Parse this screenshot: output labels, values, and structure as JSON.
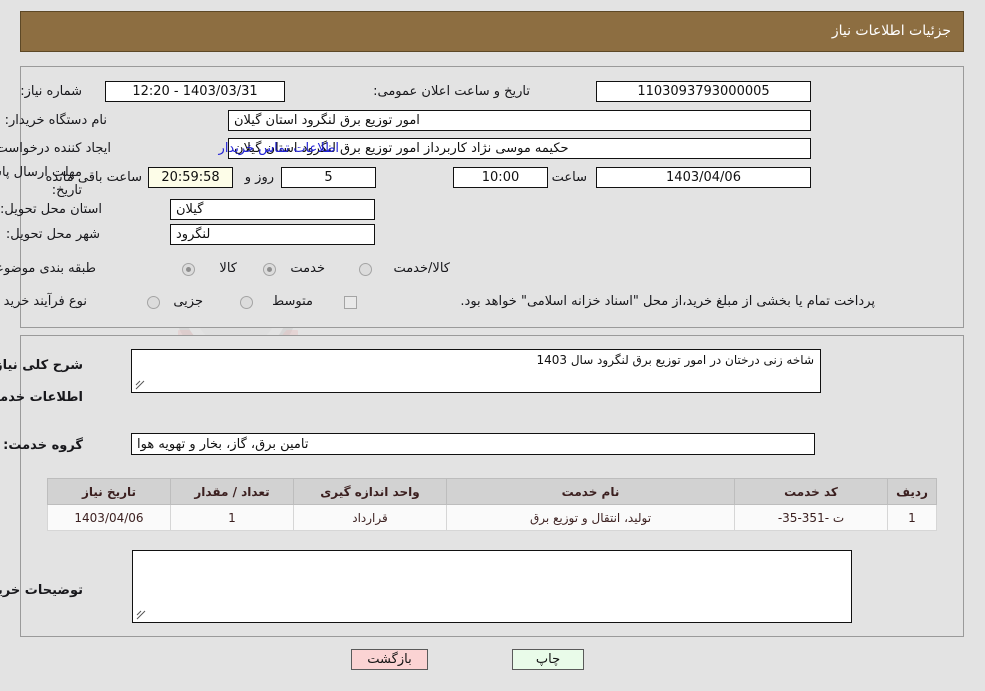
{
  "header": {
    "title": "جزئیات اطلاعات نیاز"
  },
  "form": {
    "need_number_label": "شماره نیاز:",
    "need_number_value": "1103093793000005",
    "announce_datetime_label": "تاریخ و ساعت اعلان عمومی:",
    "announce_datetime_value": "1403/03/31 - 12:20",
    "buyer_org_label": "نام دستگاه خریدار:",
    "buyer_org_value": "امور توزیع برق لنگرود استان گیلان",
    "creator_label": "ایجاد کننده درخواست:",
    "creator_value": "حکیمه موسی نژاد کاربرداز امور توزیع برق لنگرود استان گیلان",
    "buyer_contact_link": "اطلاعات تماس خریدار",
    "deadline_label_line1": "مهلت ارسال پاسخ: تا",
    "deadline_label_line2": "تاریخ:",
    "deadline_date_value": "1403/04/06",
    "hour_label": "ساعت",
    "hour_value": "10:00",
    "days_value": "5",
    "days_label": "روز و",
    "countdown_value": "20:59:58",
    "remaining_label": "ساعت باقی مانده",
    "province_label": "استان محل تحویل:",
    "province_value": "گیلان",
    "city_label": "شهر محل تحویل:",
    "city_value": "لنگرود",
    "category_label": "طبقه بندی موضوعی:",
    "category_options": [
      {
        "label": "کالا",
        "selected": false
      },
      {
        "label": "خدمت",
        "selected": true
      },
      {
        "label": "کالا/خدمت",
        "selected": false
      }
    ],
    "purchase_type_label": "نوع فرآیند خرید :",
    "purchase_type_options": [
      {
        "label": "جزیی",
        "selected": false
      },
      {
        "label": "متوسط",
        "selected": false
      }
    ],
    "treasury_checkbox_label": "پرداخت تمام یا بخشی از مبلغ خرید،از محل \"اسناد خزانه اسلامی\" خواهد بود.",
    "treasury_checked": false
  },
  "description": {
    "general_need_label": "شرح کلی نیاز:",
    "general_need_value": "شاخه زنی درختان در امور توزیع برق لنگرود سال 1403",
    "services_info_heading": "اطلاعات خدمات مورد نیاز",
    "service_group_label": "گروه خدمت:",
    "service_group_value": "تامین برق، گاز، بخار و تهویه هوا"
  },
  "table": {
    "columns": [
      "ردیف",
      "کد خدمت",
      "نام خدمت",
      "واحد اندازه گیری",
      "تعداد / مقدار",
      "تاریخ نیاز"
    ],
    "rows": [
      [
        "1",
        "ت -351-35-",
        "تولید، انتقال و توزیع برق",
        "قرارداد",
        "1",
        "1403/04/06"
      ]
    ]
  },
  "comments": {
    "buyer_comments_label": "توضیحات خریدار:",
    "buyer_comments_value": ""
  },
  "buttons": {
    "back": "بازگشت",
    "print": "چاپ"
  },
  "watermark": {
    "text": "AriaTender.net"
  },
  "colors": {
    "titlebar": "#8d6e41",
    "page_bg": "#e3e3e3",
    "link": "#2323d6",
    "timer_bg": "#fdfde8",
    "btn_back": "#fbd3d3",
    "btn_print": "#e9fbe9",
    "table_header": "#d2d2d2",
    "table_text": "#3b1f1f"
  }
}
